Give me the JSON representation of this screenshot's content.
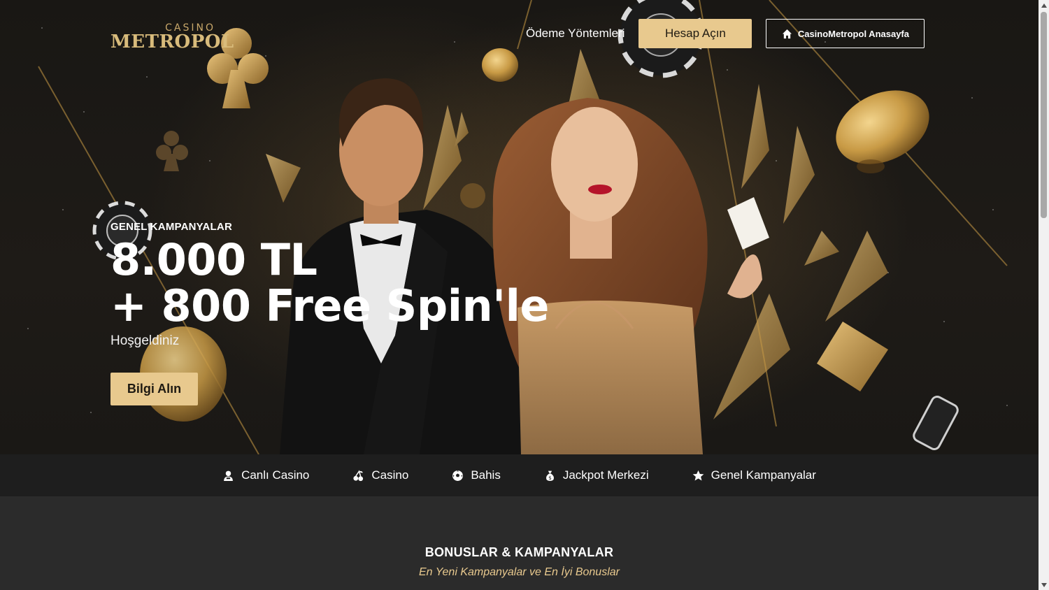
{
  "brand": {
    "logo_small": "CASINO",
    "logo_big": "METROPOL"
  },
  "top_nav": {
    "payment_link": "Ödeme Yöntemleri",
    "open_account": "Hesap Açın",
    "home_link": "CasinoMetropol Anasayfa"
  },
  "hero": {
    "eyebrow": "GENEL KAMPANYALAR",
    "headline_line1": "8.000 TL",
    "headline_line2": "+ 800 Free Spin'le",
    "subline": "Hoşgeldiniz",
    "cta": "Bilgi Alın"
  },
  "categories": [
    {
      "label": "Canlı Casino",
      "icon": "dealer-icon"
    },
    {
      "label": "Casino",
      "icon": "cherries-icon"
    },
    {
      "label": "Bahis",
      "icon": "football-icon"
    },
    {
      "label": "Jackpot Merkezi",
      "icon": "money-bag-icon"
    },
    {
      "label": "Genel Kampanyalar",
      "icon": "star-icon"
    }
  ],
  "bonus_section": {
    "title": "BONUSLAR & KAMPANYALAR",
    "subtitle": "En Yeni Kampanyalar ve En İyi Bonuslar"
  },
  "colors": {
    "accent_gold": "#e8c98e",
    "background": "#2b2b2b",
    "category_bar": "#1e1e1e"
  }
}
